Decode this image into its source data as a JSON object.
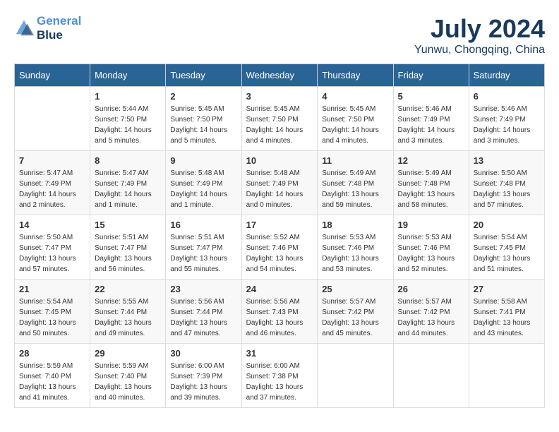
{
  "header": {
    "logo_line1": "General",
    "logo_line2": "Blue",
    "month_title": "July 2024",
    "location": "Yunwu, Chongqing, China"
  },
  "columns": [
    "Sunday",
    "Monday",
    "Tuesday",
    "Wednesday",
    "Thursday",
    "Friday",
    "Saturday"
  ],
  "weeks": [
    [
      {
        "day": "",
        "sunrise": "",
        "sunset": "",
        "daylight": ""
      },
      {
        "day": "1",
        "sunrise": "Sunrise: 5:44 AM",
        "sunset": "Sunset: 7:50 PM",
        "daylight": "Daylight: 14 hours and 5 minutes."
      },
      {
        "day": "2",
        "sunrise": "Sunrise: 5:45 AM",
        "sunset": "Sunset: 7:50 PM",
        "daylight": "Daylight: 14 hours and 5 minutes."
      },
      {
        "day": "3",
        "sunrise": "Sunrise: 5:45 AM",
        "sunset": "Sunset: 7:50 PM",
        "daylight": "Daylight: 14 hours and 4 minutes."
      },
      {
        "day": "4",
        "sunrise": "Sunrise: 5:45 AM",
        "sunset": "Sunset: 7:50 PM",
        "daylight": "Daylight: 14 hours and 4 minutes."
      },
      {
        "day": "5",
        "sunrise": "Sunrise: 5:46 AM",
        "sunset": "Sunset: 7:49 PM",
        "daylight": "Daylight: 14 hours and 3 minutes."
      },
      {
        "day": "6",
        "sunrise": "Sunrise: 5:46 AM",
        "sunset": "Sunset: 7:49 PM",
        "daylight": "Daylight: 14 hours and 3 minutes."
      }
    ],
    [
      {
        "day": "7",
        "sunrise": "Sunrise: 5:47 AM",
        "sunset": "Sunset: 7:49 PM",
        "daylight": "Daylight: 14 hours and 2 minutes."
      },
      {
        "day": "8",
        "sunrise": "Sunrise: 5:47 AM",
        "sunset": "Sunset: 7:49 PM",
        "daylight": "Daylight: 14 hours and 1 minute."
      },
      {
        "day": "9",
        "sunrise": "Sunrise: 5:48 AM",
        "sunset": "Sunset: 7:49 PM",
        "daylight": "Daylight: 14 hours and 1 minute."
      },
      {
        "day": "10",
        "sunrise": "Sunrise: 5:48 AM",
        "sunset": "Sunset: 7:49 PM",
        "daylight": "Daylight: 14 hours and 0 minutes."
      },
      {
        "day": "11",
        "sunrise": "Sunrise: 5:49 AM",
        "sunset": "Sunset: 7:48 PM",
        "daylight": "Daylight: 13 hours and 59 minutes."
      },
      {
        "day": "12",
        "sunrise": "Sunrise: 5:49 AM",
        "sunset": "Sunset: 7:48 PM",
        "daylight": "Daylight: 13 hours and 58 minutes."
      },
      {
        "day": "13",
        "sunrise": "Sunrise: 5:50 AM",
        "sunset": "Sunset: 7:48 PM",
        "daylight": "Daylight: 13 hours and 57 minutes."
      }
    ],
    [
      {
        "day": "14",
        "sunrise": "Sunrise: 5:50 AM",
        "sunset": "Sunset: 7:47 PM",
        "daylight": "Daylight: 13 hours and 57 minutes."
      },
      {
        "day": "15",
        "sunrise": "Sunrise: 5:51 AM",
        "sunset": "Sunset: 7:47 PM",
        "daylight": "Daylight: 13 hours and 56 minutes."
      },
      {
        "day": "16",
        "sunrise": "Sunrise: 5:51 AM",
        "sunset": "Sunset: 7:47 PM",
        "daylight": "Daylight: 13 hours and 55 minutes."
      },
      {
        "day": "17",
        "sunrise": "Sunrise: 5:52 AM",
        "sunset": "Sunset: 7:46 PM",
        "daylight": "Daylight: 13 hours and 54 minutes."
      },
      {
        "day": "18",
        "sunrise": "Sunrise: 5:53 AM",
        "sunset": "Sunset: 7:46 PM",
        "daylight": "Daylight: 13 hours and 53 minutes."
      },
      {
        "day": "19",
        "sunrise": "Sunrise: 5:53 AM",
        "sunset": "Sunset: 7:46 PM",
        "daylight": "Daylight: 13 hours and 52 minutes."
      },
      {
        "day": "20",
        "sunrise": "Sunrise: 5:54 AM",
        "sunset": "Sunset: 7:45 PM",
        "daylight": "Daylight: 13 hours and 51 minutes."
      }
    ],
    [
      {
        "day": "21",
        "sunrise": "Sunrise: 5:54 AM",
        "sunset": "Sunset: 7:45 PM",
        "daylight": "Daylight: 13 hours and 50 minutes."
      },
      {
        "day": "22",
        "sunrise": "Sunrise: 5:55 AM",
        "sunset": "Sunset: 7:44 PM",
        "daylight": "Daylight: 13 hours and 49 minutes."
      },
      {
        "day": "23",
        "sunrise": "Sunrise: 5:56 AM",
        "sunset": "Sunset: 7:44 PM",
        "daylight": "Daylight: 13 hours and 47 minutes."
      },
      {
        "day": "24",
        "sunrise": "Sunrise: 5:56 AM",
        "sunset": "Sunset: 7:43 PM",
        "daylight": "Daylight: 13 hours and 46 minutes."
      },
      {
        "day": "25",
        "sunrise": "Sunrise: 5:57 AM",
        "sunset": "Sunset: 7:42 PM",
        "daylight": "Daylight: 13 hours and 45 minutes."
      },
      {
        "day": "26",
        "sunrise": "Sunrise: 5:57 AM",
        "sunset": "Sunset: 7:42 PM",
        "daylight": "Daylight: 13 hours and 44 minutes."
      },
      {
        "day": "27",
        "sunrise": "Sunrise: 5:58 AM",
        "sunset": "Sunset: 7:41 PM",
        "daylight": "Daylight: 13 hours and 43 minutes."
      }
    ],
    [
      {
        "day": "28",
        "sunrise": "Sunrise: 5:59 AM",
        "sunset": "Sunset: 7:40 PM",
        "daylight": "Daylight: 13 hours and 41 minutes."
      },
      {
        "day": "29",
        "sunrise": "Sunrise: 5:59 AM",
        "sunset": "Sunset: 7:40 PM",
        "daylight": "Daylight: 13 hours and 40 minutes."
      },
      {
        "day": "30",
        "sunrise": "Sunrise: 6:00 AM",
        "sunset": "Sunset: 7:39 PM",
        "daylight": "Daylight: 13 hours and 39 minutes."
      },
      {
        "day": "31",
        "sunrise": "Sunrise: 6:00 AM",
        "sunset": "Sunset: 7:38 PM",
        "daylight": "Daylight: 13 hours and 37 minutes."
      },
      {
        "day": "",
        "sunrise": "",
        "sunset": "",
        "daylight": ""
      },
      {
        "day": "",
        "sunrise": "",
        "sunset": "",
        "daylight": ""
      },
      {
        "day": "",
        "sunrise": "",
        "sunset": "",
        "daylight": ""
      }
    ]
  ]
}
